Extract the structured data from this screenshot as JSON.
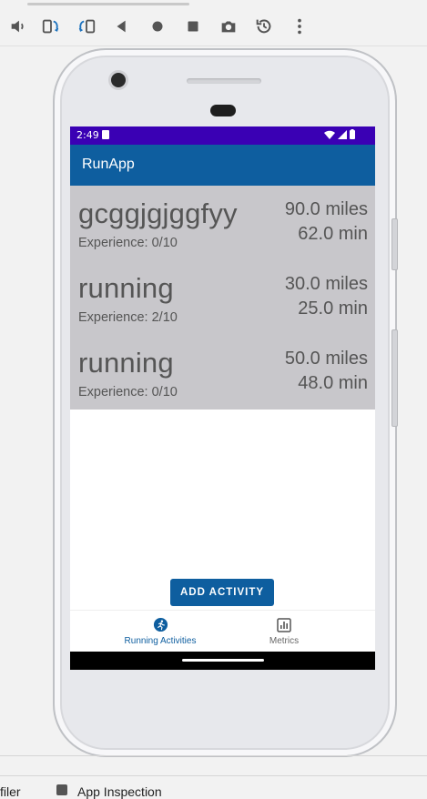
{
  "toolbar": {
    "buttons": [
      {
        "icon": "volume-icon"
      },
      {
        "icon": "rotate-left-icon"
      },
      {
        "icon": "rotate-right-icon"
      },
      {
        "icon": "back-icon"
      },
      {
        "icon": "home-icon"
      },
      {
        "icon": "overview-icon"
      },
      {
        "icon": "camera-icon"
      },
      {
        "icon": "snapshot-icon"
      },
      {
        "icon": "more-icon"
      }
    ]
  },
  "status_bar": {
    "time": "2:49"
  },
  "app": {
    "title": "RunApp",
    "accent_color": "#0e5e9f",
    "status_color": "#3a00b4"
  },
  "activities": [
    {
      "name": "gcggjgjggfyy",
      "experience": "Experience: 0/10",
      "distance": "90.0 miles",
      "duration": "62.0 min"
    },
    {
      "name": "running",
      "experience": "Experience: 2/10",
      "distance": "30.0 miles",
      "duration": "25.0 min"
    },
    {
      "name": "running",
      "experience": "Experience: 0/10",
      "distance": "50.0 miles",
      "duration": "48.0 min"
    }
  ],
  "add_button": {
    "label": "ADD ACTIVITY"
  },
  "bottom_nav": {
    "items": [
      {
        "label": "Running Activities",
        "icon": "running-icon",
        "selected": true
      },
      {
        "label": "Metrics",
        "icon": "bar-chart-icon",
        "selected": false
      }
    ]
  },
  "ide_bar": {
    "left_text": "filer",
    "app_inspection": "App Inspection"
  }
}
